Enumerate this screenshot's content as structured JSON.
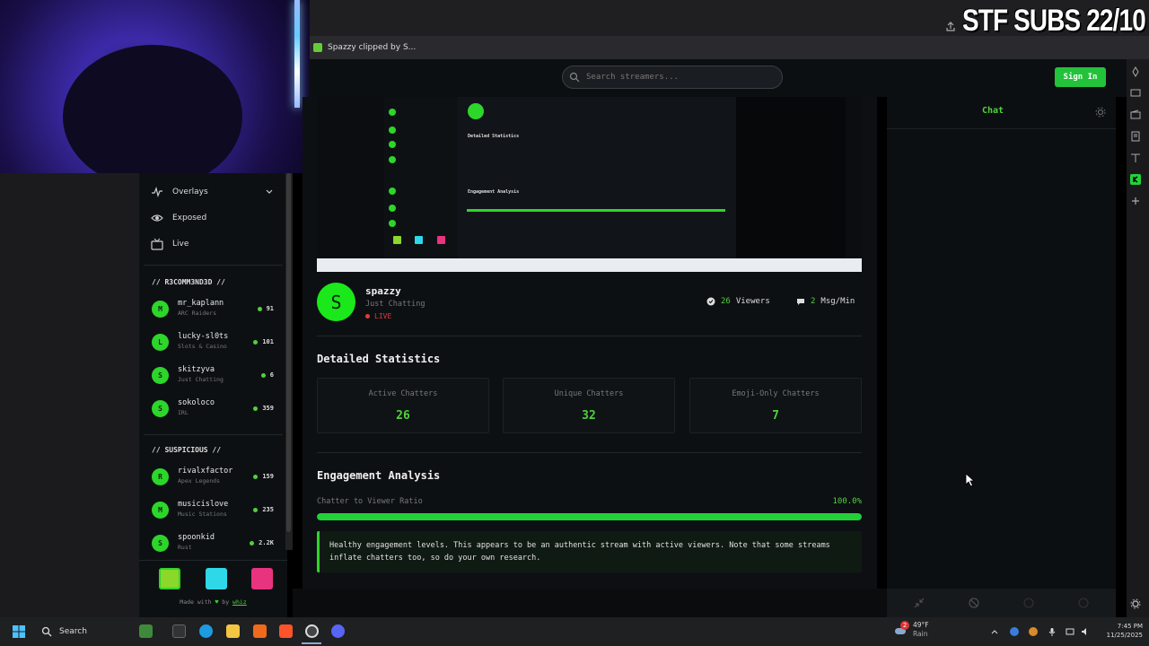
{
  "overlay": {
    "title": "STF SUBS 22/10"
  },
  "browser": {
    "tab_title": "Spazzy clipped by S..."
  },
  "header": {
    "search_placeholder": "Search streamers...",
    "sign_in": "Sign In"
  },
  "sidebar": {
    "nav": [
      {
        "label": "Overlays",
        "icon": "pulse-icon"
      },
      {
        "label": "Exposed",
        "icon": "eye-icon"
      },
      {
        "label": "Live",
        "icon": "tv-icon"
      }
    ],
    "groups": [
      {
        "title": "// R3COMM3ND3D //",
        "streamers": [
          {
            "initial": "M",
            "name": "mr_kaplann",
            "category": "ARC Raiders",
            "count": "91"
          },
          {
            "initial": "L",
            "name": "lucky-sl0ts",
            "category": "Slots & Casino",
            "count": "101"
          },
          {
            "initial": "S",
            "name": "skitzyva",
            "category": "Just Chatting",
            "count": "6"
          },
          {
            "initial": "S",
            "name": "sokoloco",
            "category": "IRL",
            "count": "359"
          }
        ]
      },
      {
        "title": "// SUSPICIOUS //",
        "streamers": [
          {
            "initial": "R",
            "name": "rivalxfactor",
            "category": "Apex Legends",
            "count": "159"
          },
          {
            "initial": "M",
            "name": "musicislove",
            "category": "Music Stations",
            "count": "235"
          },
          {
            "initial": "S",
            "name": "spoonkid",
            "category": "Rust",
            "count": "2.2K"
          }
        ]
      }
    ],
    "swatches": [
      "#8bd72a",
      "#2fd8e8",
      "#e8337f"
    ],
    "made_with": "Made with",
    "by": "by",
    "author": "whiz"
  },
  "main": {
    "streamer": {
      "initial": "S",
      "name": "spazzy",
      "category": "Just Chatting",
      "status": "LIVE"
    },
    "viewers": {
      "value": "26",
      "label": "Viewers"
    },
    "msg_rate": {
      "value": "2",
      "label": "Msg/Min"
    },
    "detailed_title": "Detailed Statistics",
    "stats": [
      {
        "label": "Active Chatters",
        "value": "26"
      },
      {
        "label": "Unique Chatters",
        "value": "32"
      },
      {
        "label": "Emoji-Only Chatters",
        "value": "7"
      }
    ],
    "engagement_title": "Engagement Analysis",
    "ratio_label": "Chatter to Viewer Ratio",
    "ratio_value": "100.0%",
    "ratio_fraction": 1.0,
    "health_message": "Healthy engagement levels. This appears to be an authentic stream with active viewers. Note that some streams inflate chatters too, so do your own research."
  },
  "chat": {
    "title": "Chat"
  },
  "taskbar": {
    "search": "Search",
    "weather_temp": "49°F",
    "weather_desc": "Rain",
    "weather_badge": "2",
    "time": "7:45 PM",
    "date": "11/25/2025"
  },
  "colors": {
    "accent": "#22d13a",
    "live": "#e53b3b",
    "background": "#0d1013"
  }
}
